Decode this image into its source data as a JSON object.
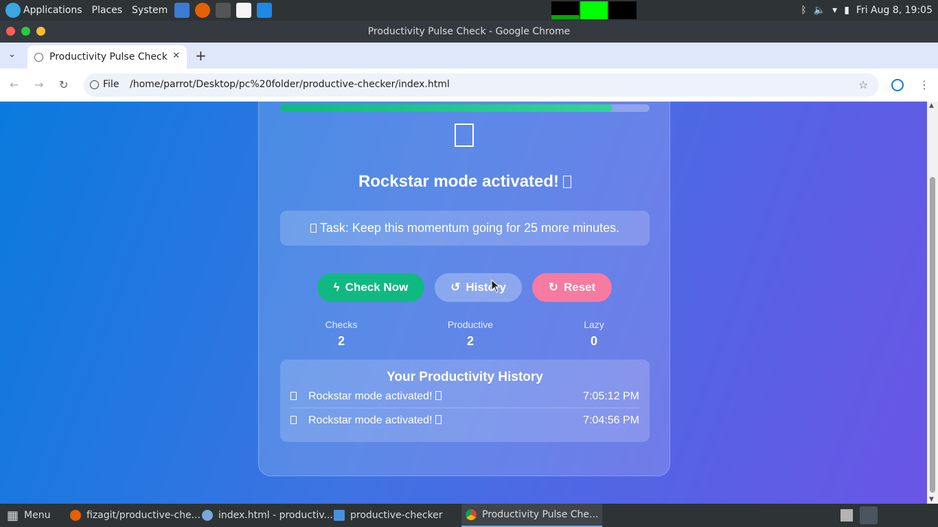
{
  "os_panel": {
    "menus": [
      "Applications",
      "Places",
      "System"
    ],
    "datetime": "Fri Aug 8, 19:05"
  },
  "window": {
    "title": "Productivity Pulse Check - Google Chrome"
  },
  "browser": {
    "tab_title": "Productivity Pulse Check",
    "scheme_label": "File",
    "url": "/home/parrot/Desktop/pc%20folder/productive-checker/index.html"
  },
  "app": {
    "progress": 0.9,
    "mood_message": "Rockstar mode activated!",
    "task_text": "Task: Keep this momentum going for 25 more minutes.",
    "buttons": {
      "check": "Check Now",
      "history": "History",
      "reset": "Reset"
    },
    "stats": [
      {
        "label": "Checks",
        "value": "2"
      },
      {
        "label": "Productive",
        "value": "2"
      },
      {
        "label": "Lazy",
        "value": "0"
      }
    ],
    "history_title": "Your Productivity History",
    "history": [
      {
        "message": "Rockstar mode activated!",
        "time": "7:05:12 PM"
      },
      {
        "message": "Rockstar mode activated!",
        "time": "7:04:56 PM"
      }
    ],
    "colors": {
      "check": "#10b981",
      "reset": "#f77aa0",
      "progress": "#34d399"
    }
  },
  "taskbar": {
    "menu_label": "Menu",
    "tasks": [
      "fizagit/productive-che...",
      "index.html - productiv...",
      "productive-checker",
      "Productivity Pulse Che..."
    ]
  }
}
